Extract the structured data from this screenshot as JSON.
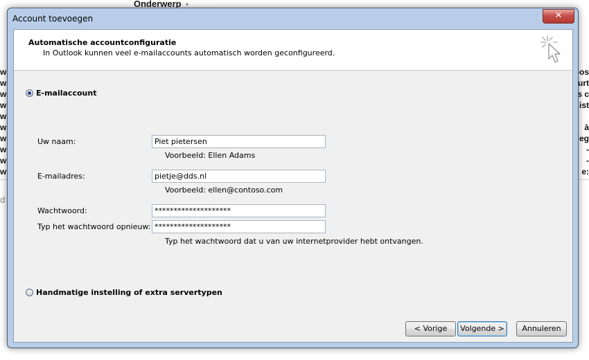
{
  "background": {
    "column_header": "Onderwerp",
    "left_fragments": [
      "ws",
      "ws",
      "ws",
      "ws",
      "ws",
      "ws",
      "ws",
      "ws",
      "ws",
      "ws"
    ],
    "right_fragments": [
      "oos",
      "urt",
      "s c",
      "ist",
      "",
      "à",
      "lleg",
      "-",
      "-",
      "e:"
    ],
    "stray_char": "d"
  },
  "dialog": {
    "title": "Account toevoegen",
    "close_label": "✕"
  },
  "header": {
    "title": "Automatische accountconfiguratie",
    "subtitle": "In Outlook kunnen veel e-mailaccounts automatisch worden geconfigureerd.",
    "icon": "cursor-sparkle-icon"
  },
  "options": {
    "email_account": {
      "label": "E-mailaccount",
      "selected": true
    },
    "manual": {
      "label": "Handmatige instelling of extra servertypen",
      "selected": false
    }
  },
  "form": {
    "name": {
      "label": "Uw naam:",
      "value": "Piet pietersen",
      "hint": "Voorbeeld: Ellen Adams"
    },
    "email": {
      "label": "E-mailadres:",
      "value": "pietje@dds.nl",
      "hint": "Voorbeeld: ellen@contoso.com"
    },
    "password": {
      "label": "Wachtwoord:",
      "value": "********************"
    },
    "password_confirm": {
      "label": "Typ het wachtwoord opnieuw:",
      "value": "********************",
      "hint": "Typ het wachtwoord dat u van uw internetprovider hebt ontvangen."
    }
  },
  "buttons": {
    "back": "< Vorige",
    "next": "Volgende >",
    "cancel": "Annuleren"
  }
}
